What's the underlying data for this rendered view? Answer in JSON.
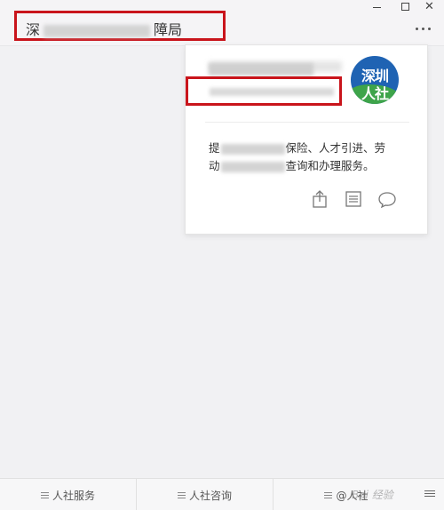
{
  "window": {
    "title_prefix": "深",
    "title_suffix": "障局",
    "controls": {
      "minimize_icon": "minimize-icon",
      "maximize_icon": "maximize-icon",
      "close_icon": "close-icon",
      "close_glyph": "✕"
    },
    "more_icon": "more-dots-icon"
  },
  "profile_card": {
    "logo_line1": "深圳",
    "logo_line2": "人社",
    "description_prefix": "提",
    "description_mid": "保险、人才引进、劳",
    "description_line2_prefix": "动",
    "description_line2_suffix": "查询和办理服务。",
    "actions": [
      "share-icon",
      "document-icon",
      "chat-icon"
    ]
  },
  "bottom_menu": {
    "items": [
      {
        "label": "人社服务"
      },
      {
        "label": "人社咨询"
      },
      {
        "label": "@人社"
      }
    ],
    "keyboard_icon": "keyboard-icon"
  },
  "watermark": "Bai 经验",
  "colors": {
    "highlight_box": "#c9141b",
    "logo_blue": "#1f63b3",
    "logo_green": "#3ea44a"
  }
}
